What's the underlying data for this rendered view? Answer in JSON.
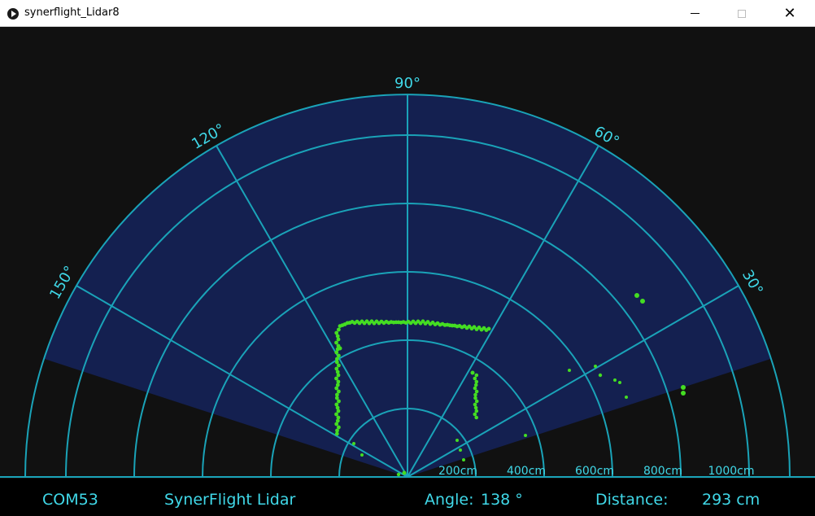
{
  "window": {
    "title": "synerflight_Lidar8",
    "minimize_icon": "minimize-icon",
    "maximize_icon": "maximize-icon",
    "close_icon": "close-icon"
  },
  "radar": {
    "angle_labels": [
      "30°",
      "60°",
      "90°",
      "120°",
      "150°"
    ],
    "range_labels": [
      "200cm",
      "400cm",
      "600cm",
      "800cm",
      "1000cm"
    ],
    "colors": {
      "background": "#111111",
      "sector": "#142050",
      "grid": "#1aa3b8",
      "text": "#40d8e8",
      "points": "#44dd22"
    }
  },
  "status": {
    "port": "COM53",
    "device": "SynerFlight Lidar",
    "angle_label": "Angle:",
    "angle_value": "138 °",
    "distance_label": "Distance:",
    "distance_value": "293 cm"
  }
}
